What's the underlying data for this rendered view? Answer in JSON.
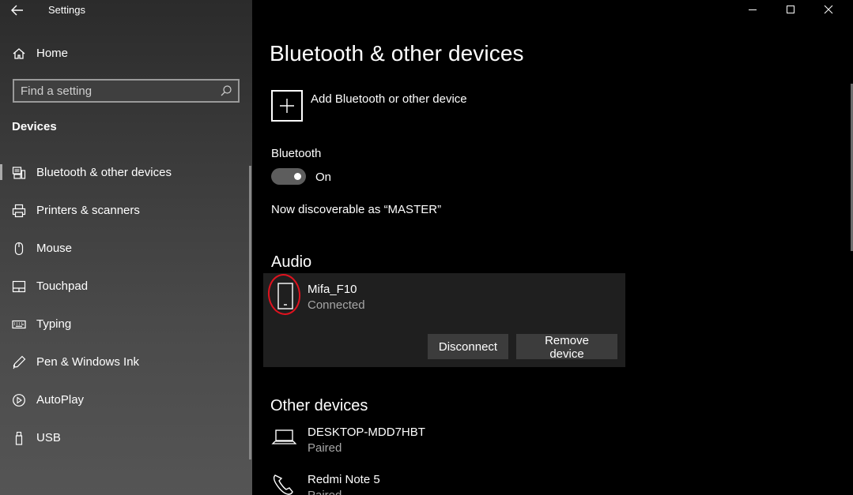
{
  "window": {
    "title": "Settings",
    "controls": {
      "minimize": "minimize",
      "maximize": "maximize",
      "close": "close"
    }
  },
  "sidebar": {
    "home_label": "Home",
    "search_placeholder": "Find a setting",
    "section_title": "Devices",
    "items": [
      {
        "label": "Bluetooth & other devices",
        "icon": "bluetooth-devices-icon",
        "active": true
      },
      {
        "label": "Printers & scanners",
        "icon": "printer-icon",
        "active": false
      },
      {
        "label": "Mouse",
        "icon": "mouse-icon",
        "active": false
      },
      {
        "label": "Touchpad",
        "icon": "touchpad-icon",
        "active": false
      },
      {
        "label": "Typing",
        "icon": "keyboard-icon",
        "active": false
      },
      {
        "label": "Pen & Windows Ink",
        "icon": "pen-icon",
        "active": false
      },
      {
        "label": "AutoPlay",
        "icon": "autoplay-icon",
        "active": false
      },
      {
        "label": "USB",
        "icon": "usb-icon",
        "active": false
      }
    ]
  },
  "main": {
    "page_title": "Bluetooth & other devices",
    "add_device_label": "Add Bluetooth or other device",
    "bluetooth_label": "Bluetooth",
    "bluetooth_state": "On",
    "discoverable_text": "Now discoverable as “MASTER”",
    "audio": {
      "heading": "Audio",
      "device": {
        "name": "Mifa_F10",
        "status": "Connected",
        "disconnect_label": "Disconnect",
        "remove_label": "Remove device"
      }
    },
    "other_devices": {
      "heading": "Other devices",
      "items": [
        {
          "name": "DESKTOP-MDD7HBT",
          "status": "Paired",
          "icon": "laptop-icon"
        },
        {
          "name": "Redmi Note 5",
          "status": "Paired",
          "icon": "phone-handset-icon"
        }
      ]
    }
  },
  "colors": {
    "sidebar_top": "#2b2b2b",
    "sidebar_bottom": "#555555",
    "main_bg": "#000000",
    "card_bg": "#1f1f1f",
    "button_bg": "#3c3c3c",
    "secondary_text": "#a6a6a6",
    "annotation_circle": "#e0121e"
  }
}
